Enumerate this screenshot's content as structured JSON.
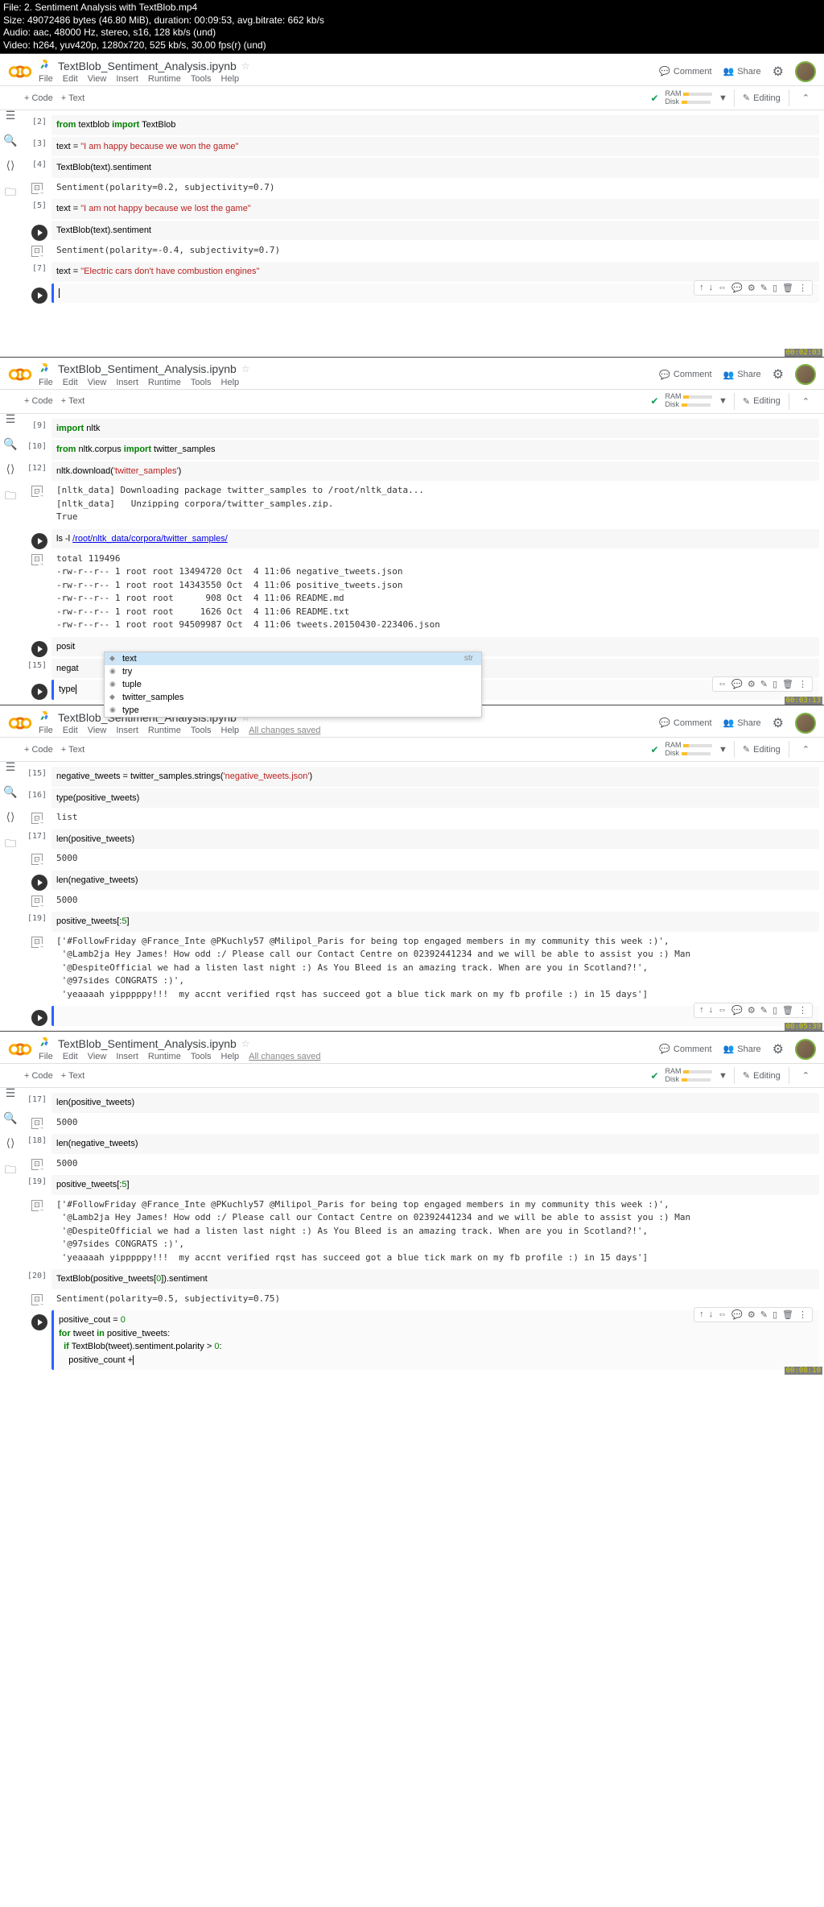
{
  "video_meta": {
    "file": "File: 2. Sentiment Analysis with TextBlob.mp4",
    "size": "Size: 49072486 bytes (46.80 MiB), duration: 00:09:53, avg.bitrate: 662 kb/s",
    "audio": "Audio: aac, 48000 Hz, stereo, s16, 128 kb/s (und)",
    "video": "Video: h264, yuv420p, 1280x720, 525 kb/s, 30.00 fps(r) (und)"
  },
  "doc": {
    "title": "TextBlob_Sentiment_Analysis.ipynb",
    "saved_msg": "All changes saved"
  },
  "menu": {
    "file": "File",
    "edit": "Edit",
    "view": "View",
    "insert": "Insert",
    "runtime": "Runtime",
    "tools": "Tools",
    "help": "Help"
  },
  "header": {
    "comment": "Comment",
    "share": "Share",
    "editing": "Editing",
    "ram": "RAM",
    "disk": "Disk",
    "code": "+ Code",
    "text": "+ Text"
  },
  "timestamps": {
    "p1": "00:02:03",
    "p2": "00:03:13",
    "p3": "00:05:39",
    "p4": "00:08:10"
  },
  "p1": {
    "c2_num": "[2]",
    "c2_code_1": "from",
    "c2_code_2": " textblob ",
    "c2_code_3": "import",
    "c2_code_4": " TextBlob",
    "c3_num": "[3]",
    "c3_pre": "text = ",
    "c3_str": "\"I am happy because we won the game\"",
    "c4_num": "[4]",
    "c4_code": "TextBlob(text).sentiment",
    "c4_out": "Sentiment(polarity=0.2, subjectivity=0.7)",
    "c5_num": "[5]",
    "c5_pre": "text = ",
    "c5_str": "\"I am not happy because we lost the game\"",
    "c6_code": "TextBlob(text).sentiment",
    "c6_out": "Sentiment(polarity=-0.4, subjectivity=0.7)",
    "c7_num": "[7]",
    "c7_pre": "text = ",
    "c7_str": "\"Electric cars don't have combustion engines\""
  },
  "p2": {
    "c9_num": "[9]",
    "c9_code_1": "import",
    "c9_code_2": " nltk",
    "c10_num": "[10]",
    "c10_1": "from",
    "c10_2": " nltk.corpus ",
    "c10_3": "import",
    "c10_4": " twitter_samples",
    "c12_num": "[12]",
    "c12_pre": "nltk.download(",
    "c12_str": "'twitter_samples'",
    "c12_post": ")",
    "c12_out": "[nltk_data] Downloading package twitter_samples to /root/nltk_data...\n[nltk_data]   Unzipping corpora/twitter_samples.zip.\nTrue",
    "c13_pre": "ls -l ",
    "c13_path": "/root/nltk_data/corpora/twitter_samples/",
    "c13_out": "total 119496\n-rw-r--r-- 1 root root 13494720 Oct  4 11:06 negative_tweets.json\n-rw-r--r-- 1 root root 14343550 Oct  4 11:06 positive_tweets.json\n-rw-r--r-- 1 root root      908 Oct  4 11:06 README.md\n-rw-r--r-- 1 root root     1626 Oct  4 11:06 README.txt\n-rw-r--r-- 1 root root 94509987 Oct  4 11:06 tweets.20150430-223406.json",
    "c14_code": "posit",
    "c15_num": "[15]",
    "c15_code": "negat",
    "typed": "type",
    "ac": {
      "i1": "text",
      "i1_type": "str",
      "i2": "try",
      "i3": "tuple",
      "i4": "twitter_samples",
      "i5": "type"
    }
  },
  "p3": {
    "c15_num": "[15]",
    "c15_pre": "negative_tweets = twitter_samples.strings(",
    "c15_str": "'negative_tweets.json'",
    "c15_post": ")",
    "c16_num": "[16]",
    "c16_code": "type(positive_tweets)",
    "c16_out": "list",
    "c17_num": "[17]",
    "c17_code": "len(positive_tweets)",
    "c17_out": "5000",
    "c18_code": "len(negative_tweets)",
    "c18_out": "5000",
    "c19_num": "[19]",
    "c19_pre": "positive_tweets[:",
    "c19_num2": "5",
    "c19_post": "]",
    "c19_out": "['#FollowFriday @France_Inte @PKuchly57 @Milipol_Paris for being top engaged members in my community this week :)',\n '@Lamb2ja Hey James! How odd :/ Please call our Contact Centre on 02392441234 and we will be able to assist you :) Man\n '@DespiteOfficial we had a listen last night :) As You Bleed is an amazing track. When are you in Scotland?!',\n '@97sides CONGRATS :)',\n 'yeaaaah yipppppy!!!  my accnt verified rqst has succeed got a blue tick mark on my fb profile :) in 15 days']"
  },
  "p4": {
    "c17_num": "[17]",
    "c17_code": "len(positive_tweets)",
    "c17_out": "5000",
    "c18_num": "[18]",
    "c18_code": "len(negative_tweets)",
    "c18_out": "5000",
    "c19_num": "[19]",
    "c19_pre": "positive_tweets[:",
    "c19_num2": "5",
    "c19_post": "]",
    "c19_out": "['#FollowFriday @France_Inte @PKuchly57 @Milipol_Paris for being top engaged members in my community this week :)',\n '@Lamb2ja Hey James! How odd :/ Please call our Contact Centre on 02392441234 and we will be able to assist you :) Man\n '@DespiteOfficial we had a listen last night :) As You Bleed is an amazing track. When are you in Scotland?!',\n '@97sides CONGRATS :)',\n 'yeaaaah yipppppy!!!  my accnt verified rqst has succeed got a blue tick mark on my fb profile :) in 15 days']",
    "c20_num": "[20]",
    "c20_pre": "TextBlob(positive_tweets[",
    "c20_idx": "0",
    "c20_post": "]).sentiment",
    "c20_out": "Sentiment(polarity=0.5, subjectivity=0.75)",
    "c21_l1_a": "positive_cout = ",
    "c21_l1_b": "0",
    "c21_l2_a": "for",
    "c21_l2_b": " tweet ",
    "c21_l2_c": "in",
    "c21_l2_d": " positive_tweets:",
    "c21_l3_a": "  if",
    "c21_l3_b": " TextBlob(tweet).sentiment.polarity > ",
    "c21_l3_c": "0",
    "c21_l3_d": ":",
    "c21_l4": "    positive_count +"
  }
}
